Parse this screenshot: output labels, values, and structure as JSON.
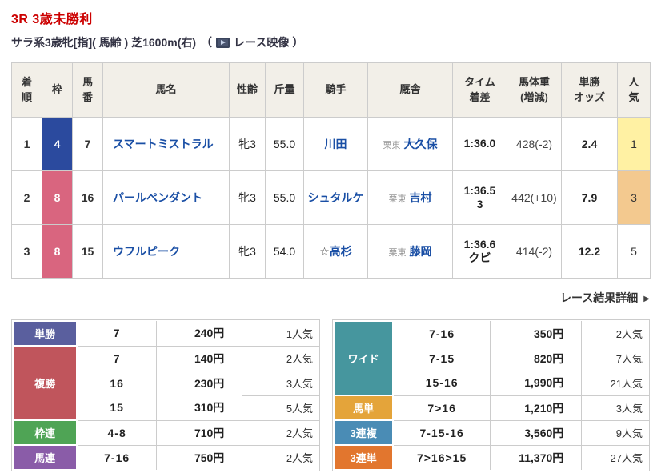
{
  "header": {
    "race_title": "3R 3歳未勝利",
    "race_conditions": "サラ系3歳牝[指]( 馬齢 ) 芝1600m(右)",
    "video_paren_open": "（",
    "video_label": "レース映像",
    "video_paren_close": "）"
  },
  "colors": {
    "title_red": "#cc0000",
    "link_blue": "#1a4fa5",
    "frame_4_blue": "#2b4a9e",
    "frame_8_pink": "#d9657f",
    "popularity_1_yellow": "#fff1a3",
    "popularity_3_tan": "#f3c98f",
    "table_header_beige": "#f2efe8"
  },
  "results": {
    "headers": [
      "着\n順",
      "枠",
      "馬\n番",
      "馬名",
      "性齢",
      "斤量",
      "騎手",
      "厩舎",
      "タイム\n着差",
      "馬体重\n(増減)",
      "単勝\nオッズ",
      "人\n気"
    ],
    "rows": [
      {
        "position": "1",
        "frame": "4",
        "frame_color": "#2b4a9e",
        "horse_number": "7",
        "horse_name": "スマートミストラル",
        "sex_age": "牝3",
        "weight": "55.0",
        "jockey_mark": "",
        "jockey": "川田",
        "stable_region": "栗東",
        "stable": "大久保",
        "time": "1:36.0",
        "margin": "",
        "horse_weight": "428(-2)",
        "odds": "2.4",
        "popularity": "1",
        "popularity_bg": "#fff1a3"
      },
      {
        "position": "2",
        "frame": "8",
        "frame_color": "#d9657f",
        "horse_number": "16",
        "horse_name": "パールペンダント",
        "sex_age": "牝3",
        "weight": "55.0",
        "jockey_mark": "",
        "jockey": "シュタルケ",
        "stable_region": "栗東",
        "stable": "吉村",
        "time": "1:36.5",
        "margin": "3",
        "horse_weight": "442(+10)",
        "odds": "7.9",
        "popularity": "3",
        "popularity_bg": "#f3c98f"
      },
      {
        "position": "3",
        "frame": "8",
        "frame_color": "#d9657f",
        "horse_number": "15",
        "horse_name": "ウフルピーク",
        "sex_age": "牝3",
        "weight": "54.0",
        "jockey_mark": "☆",
        "jockey": "高杉",
        "stable_region": "栗東",
        "stable": "藤岡",
        "time": "1:36.6",
        "margin": "クビ",
        "horse_weight": "414(-2)",
        "odds": "12.2",
        "popularity": "5",
        "popularity_bg": ""
      }
    ]
  },
  "details_link": {
    "label": "レース結果詳細",
    "arrow": "▶"
  },
  "payouts": {
    "left": [
      {
        "label": "単勝",
        "color": "#5a5f9e",
        "rows": [
          {
            "combo": "7",
            "amount": "240円",
            "popularity": "1人気"
          }
        ]
      },
      {
        "label": "複勝",
        "color": "#c0555c",
        "rows": [
          {
            "combo": "7",
            "amount": "140円",
            "popularity": "2人気"
          },
          {
            "combo": "16",
            "amount": "230円",
            "popularity": "3人気"
          },
          {
            "combo": "15",
            "amount": "310円",
            "popularity": "5人気"
          }
        ]
      },
      {
        "label": "枠連",
        "color": "#4fa455",
        "rows": [
          {
            "combo": "4-8",
            "amount": "710円",
            "popularity": "2人気"
          }
        ]
      },
      {
        "label": "馬連",
        "color": "#8a5ca8",
        "rows": [
          {
            "combo": "7-16",
            "amount": "750円",
            "popularity": "2人気"
          }
        ]
      }
    ],
    "right": [
      {
        "label": "ワイド",
        "color": "#46969e",
        "rows": [
          {
            "combo": "7-16",
            "amount": "350円",
            "popularity": "2人気"
          },
          {
            "combo": "7-15",
            "amount": "820円",
            "popularity": "7人気"
          },
          {
            "combo": "15-16",
            "amount": "1,990円",
            "popularity": "21人気"
          }
        ]
      },
      {
        "label": "馬単",
        "color": "#e4a43a",
        "rows": [
          {
            "combo": "7>16",
            "amount": "1,210円",
            "popularity": "3人気"
          }
        ]
      },
      {
        "label": "3連複",
        "color": "#4a8cb5",
        "rows": [
          {
            "combo": "7-15-16",
            "amount": "3,560円",
            "popularity": "9人気"
          }
        ]
      },
      {
        "label": "3連単",
        "color": "#e2762e",
        "rows": [
          {
            "combo": "7>16>15",
            "amount": "11,370円",
            "popularity": "27人気"
          }
        ]
      }
    ]
  }
}
